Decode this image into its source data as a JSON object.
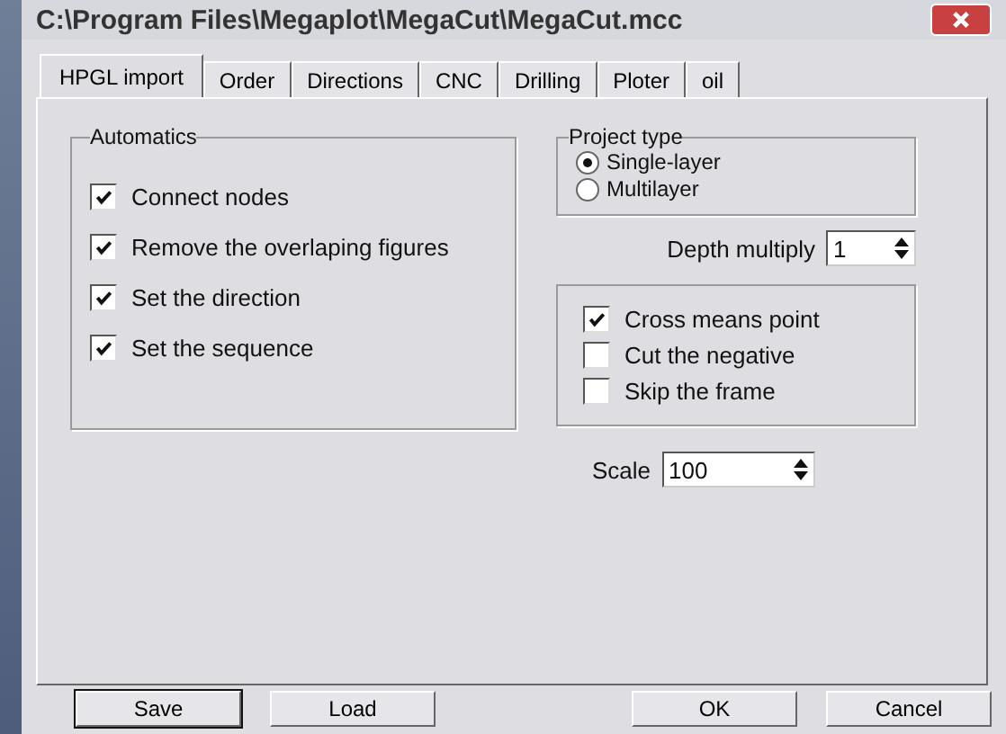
{
  "window": {
    "title": "C:\\Program Files\\Megaplot\\MegaCut\\MegaCut.mcc"
  },
  "tabs": [
    {
      "label": "HPGL import",
      "selected": true
    },
    {
      "label": "Order",
      "selected": false
    },
    {
      "label": "Directions",
      "selected": false
    },
    {
      "label": "CNC",
      "selected": false
    },
    {
      "label": "Drilling",
      "selected": false
    },
    {
      "label": "Ploter",
      "selected": false
    },
    {
      "label": "oil",
      "selected": false
    }
  ],
  "automatics": {
    "title": "Automatics",
    "items": [
      {
        "label": "Connect nodes",
        "checked": true
      },
      {
        "label": "Remove the overlaping figures",
        "checked": true
      },
      {
        "label": "Set the direction",
        "checked": true
      },
      {
        "label": "Set the sequence",
        "checked": true
      }
    ]
  },
  "project_type": {
    "title": "Project type",
    "options": [
      {
        "label": "Single-layer",
        "selected": true
      },
      {
        "label": "Multilayer",
        "selected": false
      }
    ]
  },
  "depth_multiply": {
    "label": "Depth multiply",
    "value": "1"
  },
  "options": [
    {
      "label": "Cross means point",
      "checked": true
    },
    {
      "label": "Cut the negative",
      "checked": false
    },
    {
      "label": "Skip the frame",
      "checked": false
    }
  ],
  "scale": {
    "label": "Scale",
    "value": "100"
  },
  "buttons": [
    {
      "label": "Save",
      "kind": "default"
    },
    {
      "label": "Load",
      "kind": "normal"
    },
    {
      "label": "OK",
      "kind": "normal"
    },
    {
      "label": "Cancel",
      "kind": "normal"
    }
  ]
}
